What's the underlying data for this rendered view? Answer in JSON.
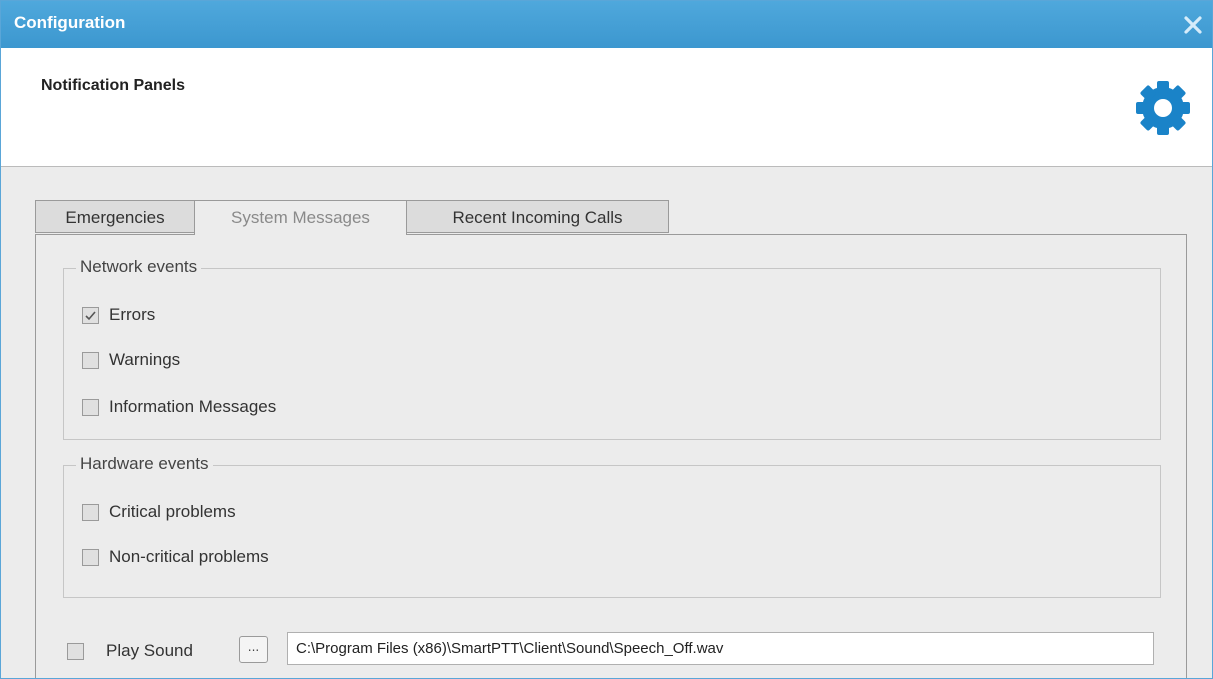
{
  "window": {
    "title": "Configuration"
  },
  "header": {
    "title": "Notification Panels"
  },
  "tabs": [
    {
      "label": "Emergencies",
      "active": false
    },
    {
      "label": "System Messages",
      "active": true
    },
    {
      "label": "Recent Incoming Calls",
      "active": false
    }
  ],
  "network_events": {
    "legend": "Network events",
    "items": [
      {
        "label": "Errors",
        "checked": true
      },
      {
        "label": "Warnings",
        "checked": false
      },
      {
        "label": "Information Messages",
        "checked": false
      }
    ]
  },
  "hardware_events": {
    "legend": "Hardware events",
    "items": [
      {
        "label": "Critical problems",
        "checked": false
      },
      {
        "label": "Non-critical problems",
        "checked": false
      }
    ]
  },
  "sound": {
    "label": "Play Sound",
    "checked": false,
    "browse_label": "...",
    "path": "C:\\Program Files (x86)\\SmartPTT\\Client\\Sound\\Speech_Off.wav"
  },
  "colors": {
    "titlebar": "#3c97cf",
    "gear": "#1a83c8",
    "close": "#cfe6f6"
  },
  "icons": {
    "close": "close-icon",
    "settings": "gear-icon",
    "check": "check-icon"
  }
}
